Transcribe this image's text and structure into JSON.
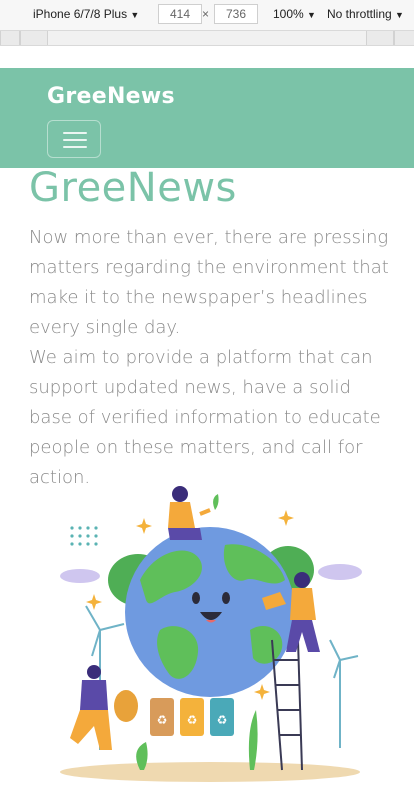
{
  "devtools": {
    "device": "iPhone 6/7/8 Plus",
    "width": "414",
    "times": "×",
    "height": "736",
    "zoom": "100%",
    "throttle": "No throttling"
  },
  "navbar": {
    "brand": "GreeNews",
    "toggle_icon": "hamburger-menu-icon"
  },
  "hero": {
    "title": "GreeNews",
    "paragraph1": "Now more than ever, there are pressing matters regarding the environment that make it to the newspaper’s headlines every single day.",
    "paragraph2": "We aim to provide a platform that can support updated news, have a solid base of verified information to educate people on these matters, and call for action."
  },
  "illustration": {
    "icon": "earth-environment-illustration",
    "colors": {
      "ocean": "#6f9ae0",
      "land": "#5fbf5a",
      "accent_orange": "#f4a93b",
      "accent_purple": "#5a4aa8",
      "teal_bin": "#4aa9b8"
    }
  }
}
